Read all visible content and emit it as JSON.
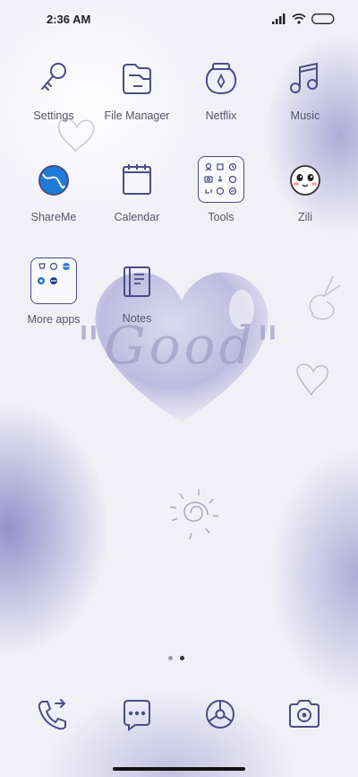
{
  "status": {
    "time": "2:36 AM"
  },
  "apps": [
    {
      "label": "Settings",
      "icon": "settings-key-icon"
    },
    {
      "label": "File Manager",
      "icon": "folder-icon"
    },
    {
      "label": "Netflix",
      "icon": "netflix-jar-icon"
    },
    {
      "label": "Music",
      "icon": "music-note-icon"
    },
    {
      "label": "ShareMe",
      "icon": "shareme-icon"
    },
    {
      "label": "Calendar",
      "icon": "calendar-icon"
    },
    {
      "label": "Tools",
      "icon": "tools-folder-icon"
    },
    {
      "label": "Zili",
      "icon": "zili-face-icon"
    },
    {
      "label": "More apps",
      "icon": "more-apps-folder-icon"
    },
    {
      "label": "Notes",
      "icon": "notes-icon"
    }
  ],
  "wallpaper": {
    "text": "\"Good\""
  },
  "pager": {
    "pages": 2,
    "active": 1
  },
  "dock": [
    {
      "icon": "phone-icon"
    },
    {
      "icon": "messages-icon"
    },
    {
      "icon": "browser-icon"
    },
    {
      "icon": "camera-icon"
    }
  ],
  "colors": {
    "icon_stroke": "#4a4d86",
    "accent_blue": "#1f7bd8"
  }
}
